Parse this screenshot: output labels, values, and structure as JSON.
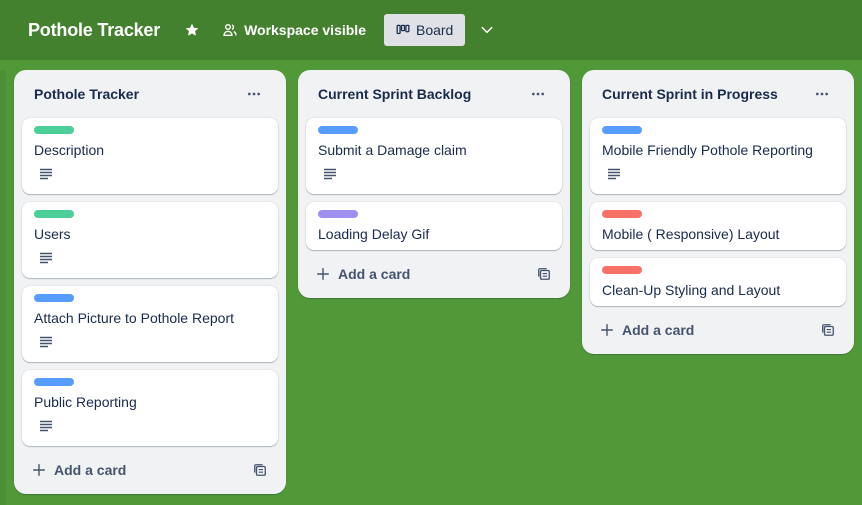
{
  "header": {
    "board_title": "Pothole Tracker",
    "star_icon": "star-icon",
    "visibility_label": "Workspace visible",
    "view_label": "Board"
  },
  "colors": {
    "background": "#519839",
    "header": "#44812f",
    "label_green": "#4bce97",
    "label_blue": "#579dff",
    "label_purple": "#9f8fef",
    "label_red": "#f87168"
  },
  "lists": [
    {
      "title": "Pothole Tracker",
      "cards": [
        {
          "title": "Description",
          "label_color": "#4bce97",
          "has_description": true
        },
        {
          "title": "Users",
          "label_color": "#4bce97",
          "has_description": true
        },
        {
          "title": "Attach Picture to Pothole Report",
          "label_color": "#579dff",
          "has_description": true
        },
        {
          "title": "Public Reporting",
          "label_color": "#579dff",
          "has_description": true
        }
      ],
      "add_card_label": "Add a card"
    },
    {
      "title": "Current Sprint Backlog",
      "cards": [
        {
          "title": "Submit a Damage claim",
          "label_color": "#579dff",
          "has_description": true
        },
        {
          "title": "Loading Delay Gif",
          "label_color": "#9f8fef",
          "has_description": false
        }
      ],
      "add_card_label": "Add a card"
    },
    {
      "title": "Current Sprint in Progress",
      "cards": [
        {
          "title": "Mobile Friendly Pothole Reporting",
          "label_color": "#579dff",
          "has_description": true
        },
        {
          "title": "Mobile ( Responsive) Layout",
          "label_color": "#f87168",
          "has_description": false
        },
        {
          "title": "Clean-Up Styling and Layout",
          "label_color": "#f87168",
          "has_description": false
        }
      ],
      "add_card_label": "Add a card"
    }
  ]
}
